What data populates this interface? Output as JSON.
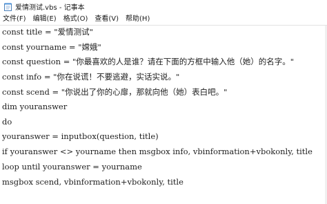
{
  "window": {
    "title": "爱情测试.vbs - 记事本",
    "icon": "notepad-icon"
  },
  "menu": [
    {
      "label": "文件(F)"
    },
    {
      "label": "编辑(E)"
    },
    {
      "label": "格式(O)"
    },
    {
      "label": "查看(V)"
    },
    {
      "label": "帮助(H)"
    }
  ],
  "editor": {
    "lines": [
      "const title = \"爱情测试\"",
      "const yourname = \"嫦娥\"",
      "const question = \"你最喜欢的人是谁？请在下面的方框中输入他（她）的名字。\"",
      "const info = \"你在说谎！不要逃避，实话实说。\"",
      "const scend = \"你说出了你的心扉，那就向他（她）表白吧。\"",
      "dim youranswer",
      "do",
      "youranswer = inputbox(question, title)",
      "if youranswer <> yourname then msgbox info, vbinformation+vbokonly, title",
      "loop until youranswer = yourname",
      "msgbox scend, vbinformation+vbokonly, title"
    ]
  }
}
